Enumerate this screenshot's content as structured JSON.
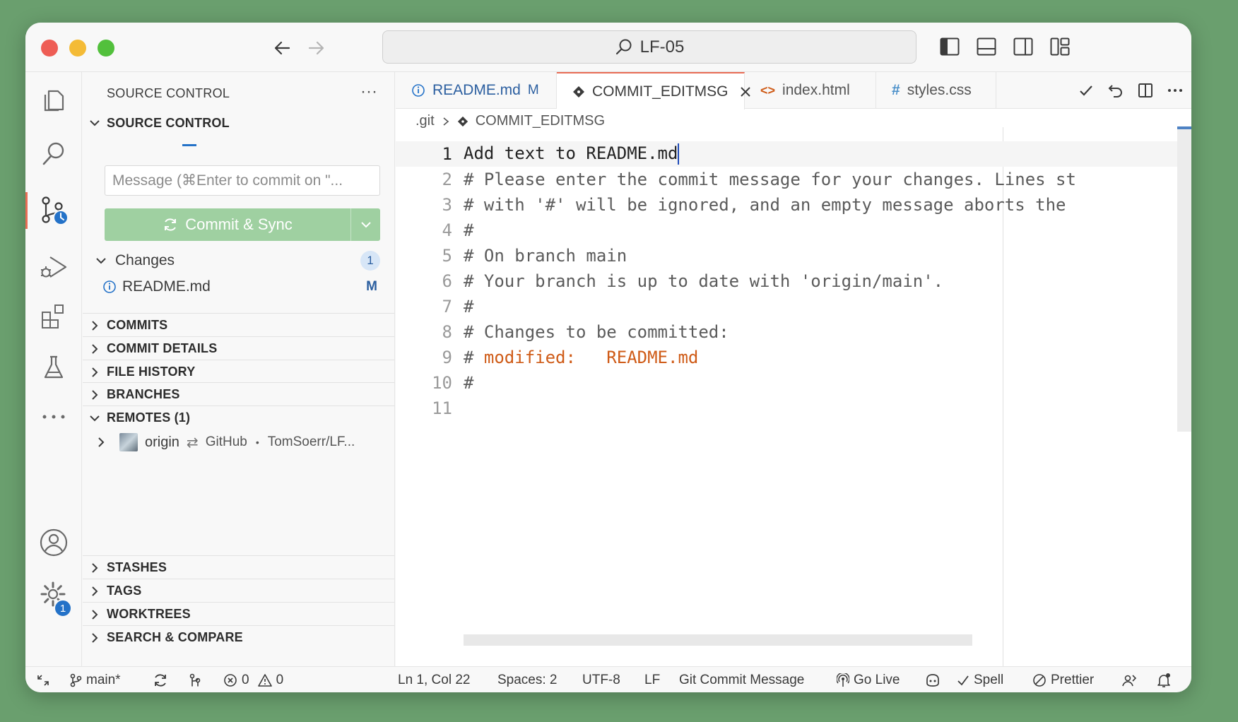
{
  "window": {
    "search_text": "LF-05"
  },
  "sidebar": {
    "title": "SOURCE CONTROL",
    "section_title": "SOURCE CONTROL",
    "message_placeholder": "Message (⌘Enter to commit on \"...",
    "commit_button_label": "Commit & Sync",
    "changes": {
      "label": "Changes",
      "count": "1",
      "files": [
        {
          "name": "README.md",
          "status": "M"
        }
      ]
    },
    "sections": [
      {
        "label": "COMMITS"
      },
      {
        "label": "COMMIT DETAILS"
      },
      {
        "label": "FILE HISTORY"
      },
      {
        "label": "BRANCHES"
      },
      {
        "label": "REMOTES (1)"
      }
    ],
    "remote": {
      "name": "origin",
      "provider": "GitHub",
      "separator": "•",
      "repo": "TomSoerr/LF..."
    },
    "bottom_sections": [
      {
        "label": "STASHES"
      },
      {
        "label": "TAGS"
      },
      {
        "label": "WORKTREES"
      },
      {
        "label": "SEARCH & COMPARE"
      }
    ]
  },
  "activity": {
    "settings_badge": "1"
  },
  "tabs": [
    {
      "label": "README.md",
      "suffix": "M"
    },
    {
      "label": "COMMIT_EDITMSG"
    },
    {
      "label": "index.html"
    },
    {
      "label": "styles.css"
    }
  ],
  "breadcrumb": {
    "folder": ".git",
    "file": "COMMIT_EDITMSG"
  },
  "editor": {
    "lines": [
      {
        "n": "1",
        "text": "Add text to README.md"
      },
      {
        "n": "2",
        "text": "# Please enter the commit message for your changes. Lines st"
      },
      {
        "n": "3",
        "text": "# with '#' will be ignored, and an empty message aborts the"
      },
      {
        "n": "4",
        "text": "#"
      },
      {
        "n": "5",
        "text": "# On branch main"
      },
      {
        "n": "6",
        "text": "# Your branch is up to date with 'origin/main'."
      },
      {
        "n": "7",
        "text": "#"
      },
      {
        "n": "8",
        "text": "# Changes to be committed:"
      },
      {
        "n": "9",
        "prefix": "# ",
        "keyword": "modified:   README.md"
      },
      {
        "n": "10",
        "text": "#"
      },
      {
        "n": "11",
        "text": ""
      }
    ]
  },
  "statusbar": {
    "branch": "main*",
    "errors": "0",
    "warnings": "0",
    "position": "Ln 1, Col 22",
    "spaces": "Spaces: 2",
    "encoding": "UTF-8",
    "eol": "LF",
    "language": "Git Commit Message",
    "go_live": "Go Live",
    "spell": "Spell",
    "prettier": "Prettier"
  },
  "colors": {
    "accent": "#2472c8",
    "commit_button": "#9fd0a1",
    "active_tab_border": "#e86c55",
    "keyword": "#cf5b17",
    "background": "#6a9f6e"
  }
}
